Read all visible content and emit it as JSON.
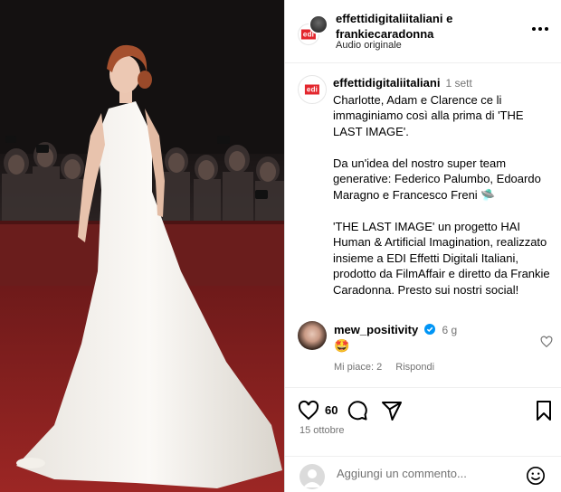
{
  "header": {
    "names": "effettidigitaliitaliani e frankiecaradonna",
    "audio": "Audio originale",
    "avatar_logo": "edi",
    "more_icon": "more-horizontal-icon"
  },
  "caption": {
    "username": "effettidigitaliitaliani",
    "time": "1 sett",
    "avatar_logo": "edi",
    "paragraph1": "Charlotte, Adam e Clarence ce li immaginiamo così alla prima di 'THE LAST IMAGE'.",
    "paragraph2": "Da un'idea del nostro super team generative: Federico Palumbo, Edoardo Maragno e Francesco Freni 🛸",
    "paragraph3": "'THE LAST IMAGE' un progetto HAI Human & Artificial Imagination, realizzato insieme a EDI Effetti Digitali Italiani, prodotto da FilmAffair e diretto da Frankie Caradonna. Presto sui nostri social!"
  },
  "comment": {
    "username": "mew_positivity",
    "time": "6 g",
    "text": "🤩",
    "likes": "Mi piace: 2",
    "reply": "Rispondi",
    "verified_icon": "verified-badge-icon"
  },
  "actions": {
    "like_count": "60",
    "date": "15 ottobre",
    "icons": [
      "heart-icon",
      "comment-icon",
      "share-icon",
      "bookmark-icon"
    ]
  },
  "add_comment": {
    "placeholder": "Aggiungi un commento..."
  },
  "colors": {
    "accent_blue": "#0095f6",
    "edi_red": "#e3262d",
    "muted_text": "#737373",
    "carpet_red": "#8e2222"
  }
}
